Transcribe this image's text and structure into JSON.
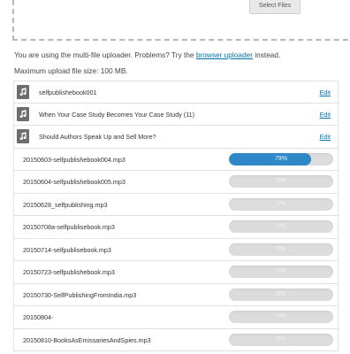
{
  "uploader": {
    "select_files_label": "Select Files",
    "info_text": "You are using the multi-file uploader. Problems? Try the",
    "browser_uploader_link": "browser uploader",
    "info_suffix": "instead.",
    "max_size_text": "Maximum upload file size: 100 MB."
  },
  "media_items": [
    {
      "title": "selfpublishebook001",
      "edit_label": "Edit",
      "icon": "audio-file-icon"
    },
    {
      "title": "When Your Case Study Becomes Your Case Study (11)",
      "edit_label": "Edit",
      "icon": "audio-file-icon"
    },
    {
      "title": "Should Authors Speak Up and Sell More?",
      "edit_label": "Edit",
      "icon": "audio-file-icon"
    }
  ],
  "uploads": [
    {
      "filename": "20150603-selfpublishebook004.mp3",
      "percent": 79,
      "percent_label": "79%"
    },
    {
      "filename": "20150604-selfpublishebook005.mp3",
      "percent": 0,
      "percent_label": "0%"
    },
    {
      "filename": "20150628_selfpublishing.mp3",
      "percent": 0,
      "percent_label": "0%"
    },
    {
      "filename": "20150708a-selfpublisebook.mp3",
      "percent": 0,
      "percent_label": "0%"
    },
    {
      "filename": "20150714-selfpublisebook.mp3",
      "percent": 0,
      "percent_label": "0%"
    },
    {
      "filename": "20150723-selfpublishebook.mp3",
      "percent": 0,
      "percent_label": "0%"
    },
    {
      "filename": "20150730-SelfPublishingFromIndia.mp3",
      "percent": 0,
      "percent_label": "0%"
    },
    {
      "filename": "20150804-",
      "percent": 0,
      "percent_label": "0%"
    },
    {
      "filename": "20150810-BooksAsEmissariesAndSpies.mp3",
      "percent": 0,
      "percent_label": "0%"
    }
  ],
  "colors": {
    "link": "#0073aa",
    "progress_fill": "#2e88c8",
    "progress_track": "#dcdcdc"
  }
}
